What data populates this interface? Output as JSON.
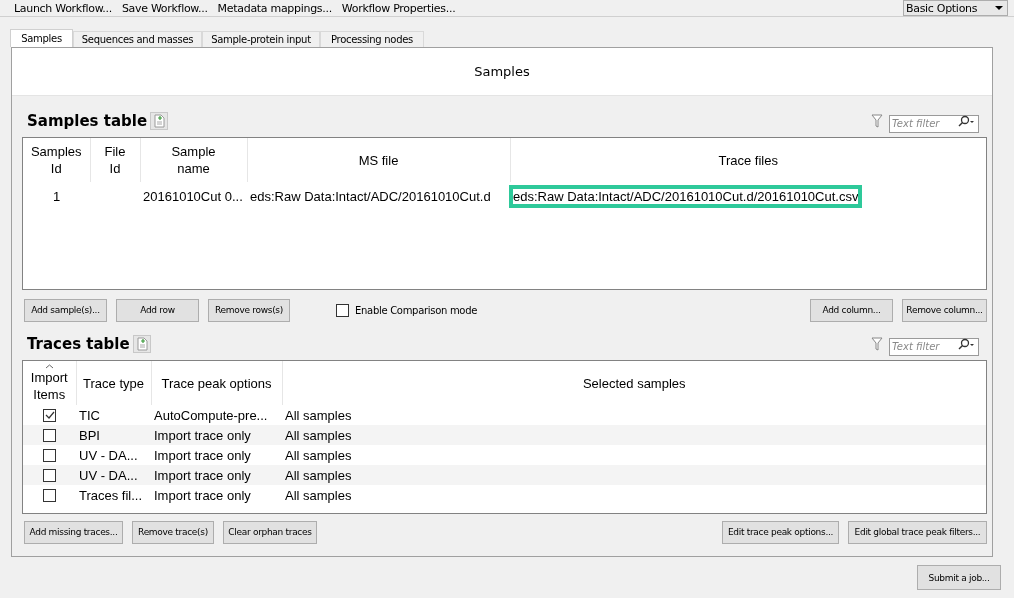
{
  "toolbar": {
    "items": [
      "Launch Workflow...",
      "Save Workflow...",
      "Metadata mappings...",
      "Workflow Properties..."
    ],
    "mode_select": {
      "value": "Basic Options"
    }
  },
  "tabs": [
    {
      "label": "Samples",
      "selected": true
    },
    {
      "label": "Sequences and masses",
      "selected": false
    },
    {
      "label": "Sample-protein input",
      "selected": false
    },
    {
      "label": "Processing nodes",
      "selected": false
    }
  ],
  "panel_title": "Samples",
  "samples_table": {
    "title": "Samples table",
    "filter": {
      "placeholder": "Text filter"
    },
    "columns": [
      "Samples\nId",
      "File\nId",
      "Sample\nname",
      "MS file",
      "Trace files"
    ],
    "rows": [
      {
        "samples_id": "1",
        "sample_name": "20161010Cut 0...",
        "ms_file": "eds:Raw Data:Intact/ADC/20161010Cut.d",
        "trace_files": {
          "text": "eds:Raw Data:Intact/ADC/20161010Cut.d/20161010Cut.csv",
          "highlighted": true
        }
      }
    ],
    "buttons_left": [
      "Add sample(s)...",
      "Add row",
      "Remove rows(s)"
    ],
    "comparison_mode": {
      "label": "Enable Comparison mode",
      "checked": false
    },
    "buttons_right": [
      "Add column...",
      "Remove column..."
    ]
  },
  "traces_table": {
    "title": "Traces table",
    "filter": {
      "placeholder": "Text filter"
    },
    "columns": [
      {
        "label": "Import\nItems",
        "sorted": true
      },
      {
        "label": "Trace type",
        "sorted": false
      },
      {
        "label": "Trace peak options",
        "sorted": false
      },
      {
        "label": "Selected samples",
        "sorted": false
      }
    ],
    "rows": [
      {
        "checked": true,
        "trace_type": "TIC",
        "peak_options": "AutoCompute-pre...",
        "selected_samples": "All samples"
      },
      {
        "checked": false,
        "trace_type": "BPI",
        "peak_options": "Import trace only",
        "selected_samples": "All samples"
      },
      {
        "checked": false,
        "trace_type": "UV - DA...",
        "peak_options": "Import trace only",
        "selected_samples": "All samples"
      },
      {
        "checked": false,
        "trace_type": "UV - DA...",
        "peak_options": "Import trace only",
        "selected_samples": "All samples"
      },
      {
        "checked": false,
        "trace_type": "Traces fil...",
        "peak_options": "Import trace only",
        "selected_samples": "All samples"
      }
    ],
    "buttons_left": [
      "Add missing traces...",
      "Remove trace(s)",
      "Clear orphan traces"
    ],
    "buttons_right": [
      "Edit trace peak options...",
      "Edit global trace peak filters..."
    ]
  },
  "submit_button": "Submit a job..."
}
